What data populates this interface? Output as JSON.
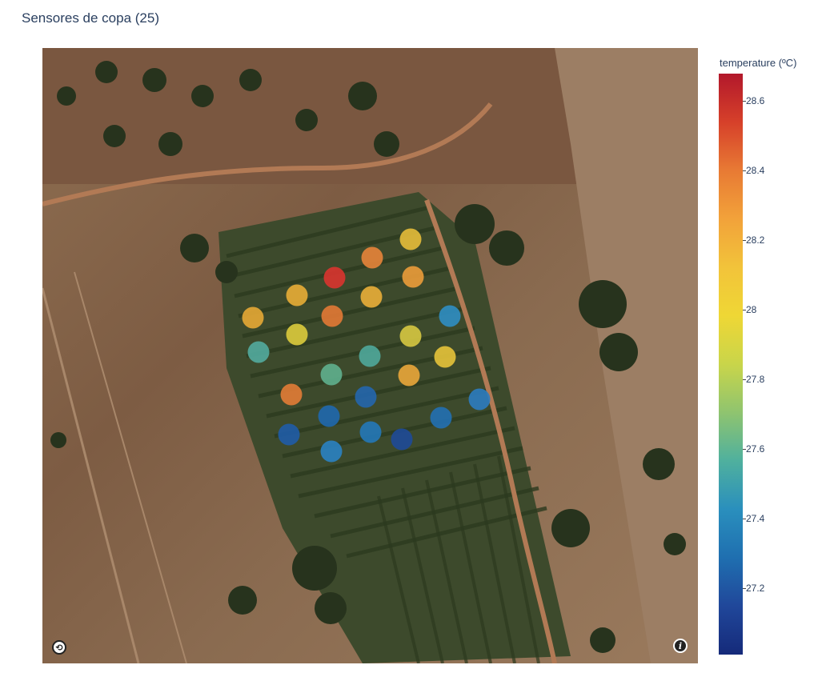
{
  "title": "Sensores de copa (25)",
  "colorbar": {
    "title": "temperature (ºC)",
    "ticks": [
      "28.6",
      "28.4",
      "28.2",
      "28",
      "27.8",
      "27.6",
      "27.4",
      "27.2"
    ],
    "colors": [
      "#b2182b",
      "#d6402a",
      "#e87a34",
      "#f2a23a",
      "#f2c33a",
      "#efd735",
      "#c9d54a",
      "#8fc46f",
      "#4fb09e",
      "#2a8fbd",
      "#1f6fb0",
      "#20479a",
      "#152a7a"
    ]
  },
  "map": {
    "base": "satellite imagery",
    "controls": {
      "reset_icon": "reset-view-icon",
      "info_icon": "info-icon"
    }
  },
  "sensors": [
    {
      "lat_rank": 1,
      "temperature": 28.0,
      "color": "#e6bd3a"
    },
    {
      "lat_rank": 2,
      "temperature": 28.3,
      "color": "#e7843a"
    },
    {
      "lat_rank": 3,
      "temperature": 28.65,
      "color": "#d9342f"
    },
    {
      "lat_rank": 4,
      "temperature": 28.2,
      "color": "#eb9c3a"
    },
    {
      "lat_rank": 5,
      "temperature": 28.1,
      "color": "#e8ad36"
    },
    {
      "lat_rank": 6,
      "temperature": 28.1,
      "color": "#e9ae38"
    },
    {
      "lat_rank": 7,
      "temperature": 28.1,
      "color": "#e5a935"
    },
    {
      "lat_rank": 8,
      "temperature": 28.35,
      "color": "#e27935"
    },
    {
      "lat_rank": 9,
      "temperature": 27.4,
      "color": "#2f8ec3"
    },
    {
      "lat_rank": 10,
      "temperature": 27.9,
      "color": "#dccb3c"
    },
    {
      "lat_rank": 11,
      "temperature": 27.85,
      "color": "#d6c841"
    },
    {
      "lat_rank": 12,
      "temperature": 27.55,
      "color": "#52ab9f"
    },
    {
      "lat_rank": 13,
      "temperature": 27.55,
      "color": "#4fa89b"
    },
    {
      "lat_rank": 14,
      "temperature": 27.95,
      "color": "#e5c33a"
    },
    {
      "lat_rank": 15,
      "temperature": 27.6,
      "color": "#5fb08e"
    },
    {
      "lat_rank": 16,
      "temperature": 28.15,
      "color": "#e9a63a"
    },
    {
      "lat_rank": 17,
      "temperature": 28.3,
      "color": "#e27c36"
    },
    {
      "lat_rank": 18,
      "temperature": 27.35,
      "color": "#2c7cc0"
    },
    {
      "lat_rank": 19,
      "temperature": 27.3,
      "color": "#2466ad"
    },
    {
      "lat_rank": 20,
      "temperature": 27.3,
      "color": "#1f68ae"
    },
    {
      "lat_rank": 21,
      "temperature": 27.3,
      "color": "#2270b3"
    },
    {
      "lat_rank": 22,
      "temperature": 27.25,
      "color": "#1f5ca7"
    },
    {
      "lat_rank": 23,
      "temperature": 27.35,
      "color": "#2478b8"
    },
    {
      "lat_rank": 24,
      "temperature": 27.2,
      "color": "#1e4a98"
    },
    {
      "lat_rank": 25,
      "temperature": 27.4,
      "color": "#2a82c2"
    }
  ]
}
